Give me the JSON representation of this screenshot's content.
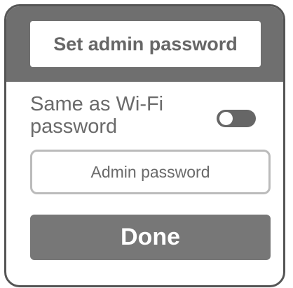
{
  "dialog": {
    "title": "Set admin password",
    "toggle": {
      "label_line1": "Same as Wi-Fi",
      "label_line2": "password",
      "state": "off"
    },
    "password_field": {
      "value": "",
      "placeholder": "Admin password"
    },
    "done_label": "Done"
  },
  "colors": {
    "header": "#6f6f6f",
    "frame_border": "#555555",
    "text": "#6a6a6a",
    "button": "#777777",
    "input_border": "#bbbbbb"
  }
}
